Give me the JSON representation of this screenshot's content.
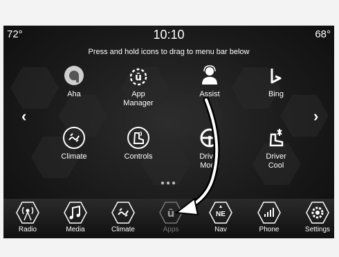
{
  "status": {
    "temp_left": "72°",
    "clock": "10:10",
    "temp_right": "68°"
  },
  "instruction": "Press and hold icons to drag to menu bar below",
  "apps": [
    {
      "label": "Aha",
      "icon": "aha-icon"
    },
    {
      "label": "App\nManager",
      "icon": "app-manager-icon"
    },
    {
      "label": "Assist",
      "icon": "assist-icon"
    },
    {
      "label": "Bing",
      "icon": "bing-icon"
    },
    {
      "label": "Climate",
      "icon": "climate-icon"
    },
    {
      "label": "Controls",
      "icon": "controls-icon"
    },
    {
      "label": "Driver\nMode",
      "icon": "driver-mode-icon"
    },
    {
      "label": "Driver\nCool",
      "icon": "driver-cool-icon"
    }
  ],
  "nav": {
    "prev": "‹",
    "next": "›"
  },
  "page_dots": "●●●",
  "menubar": [
    {
      "label": "Radio",
      "icon": "radio-icon"
    },
    {
      "label": "Media",
      "icon": "media-icon"
    },
    {
      "label": "Climate",
      "icon": "climate-icon"
    },
    {
      "label": "Apps",
      "icon": "apps-icon"
    },
    {
      "label": "Nav",
      "icon": "nav-icon",
      "badge": "NE"
    },
    {
      "label": "Phone",
      "icon": "phone-icon"
    },
    {
      "label": "Settings",
      "icon": "settings-icon"
    }
  ]
}
